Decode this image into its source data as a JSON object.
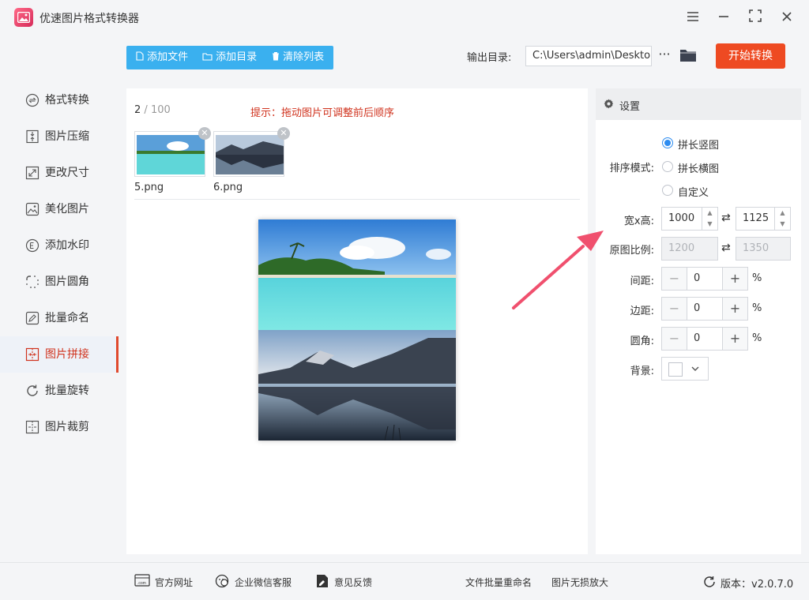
{
  "app": {
    "title": "优速图片格式转换器"
  },
  "sidebar": {
    "items": [
      {
        "label": "格式转换"
      },
      {
        "label": "图片压缩"
      },
      {
        "label": "更改尺寸"
      },
      {
        "label": "美化图片"
      },
      {
        "label": "添加水印"
      },
      {
        "label": "图片圆角"
      },
      {
        "label": "批量命名"
      },
      {
        "label": "图片拼接",
        "active": true
      },
      {
        "label": "批量旋转"
      },
      {
        "label": "图片裁剪"
      }
    ]
  },
  "toolbar": {
    "add_file": "添加文件",
    "add_dir": "添加目录",
    "clear_list": "清除列表",
    "output_label": "输出目录:",
    "output_path": "C:\\Users\\admin\\Deskto",
    "more": "···",
    "start": "开始转换"
  },
  "filelist": {
    "count": "2",
    "separator": " / ",
    "max": "100",
    "hint": "提示：拖动图片可调整前后顺序",
    "files": [
      {
        "name": "5.png"
      },
      {
        "name": "6.png"
      }
    ]
  },
  "settings": {
    "title": "设置",
    "sort_label": "排序模式:",
    "modes": [
      {
        "label": "拼长竖图",
        "checked": true
      },
      {
        "label": "拼长横图",
        "checked": false
      },
      {
        "label": "自定义",
        "checked": false
      }
    ],
    "size_label": "宽x高:",
    "width": "1000",
    "height": "1125",
    "ratio_label": "原图比例:",
    "ratio_w": "1200",
    "ratio_h": "1350",
    "spacing_label": "间距:",
    "spacing": "0",
    "margin_label": "边距:",
    "margin": "0",
    "radius_label": "圆角:",
    "radius": "0",
    "percent": "%",
    "bg_label": "背景:",
    "bg_color": "#ffffff"
  },
  "footer": {
    "website": "官方网址",
    "wechat": "企业微信客服",
    "feedback": "意见反馈",
    "batch_rename": "文件批量重命名",
    "lossless": "图片无损放大",
    "version_label": "版本：",
    "version": "v2.0.7.0"
  },
  "colors": {
    "accent_blue": "#3ab0ef",
    "start_orange": "#ee4a22",
    "active_red": "#d0331e",
    "arrow_red": "#f0506e"
  }
}
